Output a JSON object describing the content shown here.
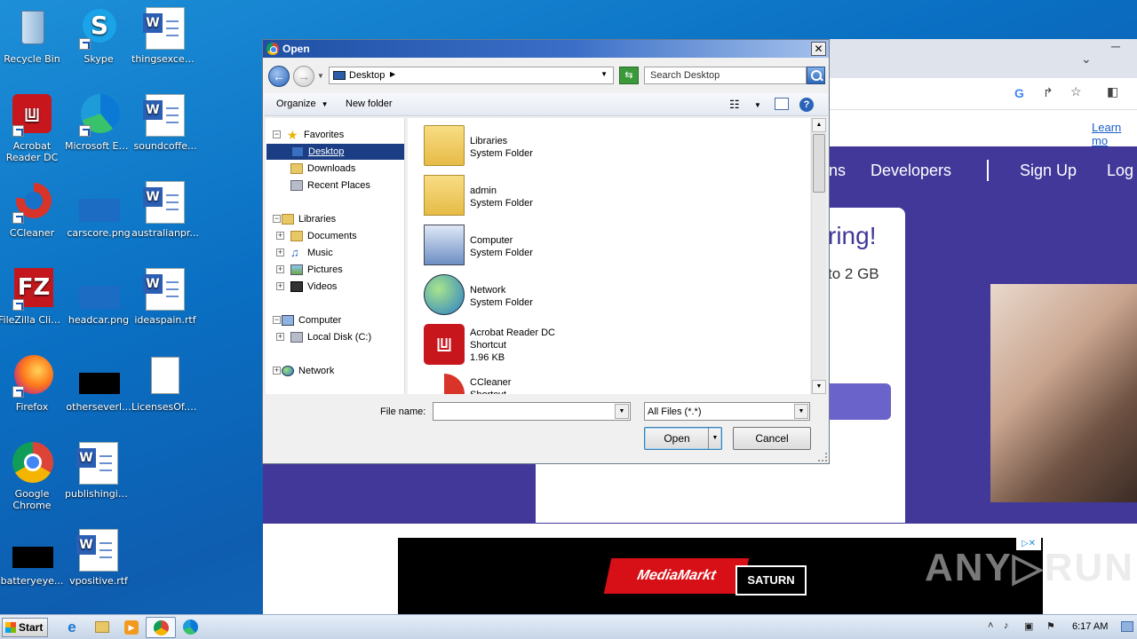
{
  "desktop": {
    "icons": [
      {
        "label": "Recycle Bin",
        "icon": "recycle-bin-icon"
      },
      {
        "label": "Skype",
        "icon": "skype-icon"
      },
      {
        "label": "thingsexcep...",
        "icon": "word-doc-icon"
      },
      {
        "label": "Acrobat Reader DC",
        "icon": "acrobat-icon"
      },
      {
        "label": "Microsoft Edge",
        "icon": "edge-icon"
      },
      {
        "label": "soundcoffe...",
        "icon": "word-doc-icon"
      },
      {
        "label": "CCleaner",
        "icon": "ccleaner-icon"
      },
      {
        "label": "carscore.png",
        "icon": "image-icon"
      },
      {
        "label": "australianpr...",
        "icon": "word-doc-icon"
      },
      {
        "label": "FileZilla Client",
        "icon": "filezilla-icon"
      },
      {
        "label": "headcar.png",
        "icon": "image-icon"
      },
      {
        "label": "ideaspain.rtf",
        "icon": "word-doc-icon"
      },
      {
        "label": "Firefox",
        "icon": "firefox-icon"
      },
      {
        "label": "otherseverl...",
        "icon": "black-thumbnail-icon"
      },
      {
        "label": "LicensesOf.txt",
        "icon": "text-file-icon"
      },
      {
        "label": "Google Chrome",
        "icon": "chrome-icon"
      },
      {
        "label": "publishingin...",
        "icon": "word-doc-icon"
      },
      {
        "label": "batteryeye...",
        "icon": "black-thumbnail-icon"
      },
      {
        "label": "vpositive.rtf",
        "icon": "word-doc-icon"
      }
    ]
  },
  "browser": {
    "learn_more": "Learn mo",
    "nav": [
      "ns",
      "Developers",
      "Sign Up",
      "Log"
    ],
    "headline": "ring!",
    "subline": "to 2 GB",
    "ad": {
      "brand1": "MediaMarkt",
      "brand2": "SATURN",
      "badge": "▷✕"
    },
    "watermark": "ANY▷RUN"
  },
  "dialog": {
    "title": "Open",
    "address": "Desktop",
    "search_placeholder": "Search Desktop",
    "toolbar": {
      "organize": "Organize",
      "new_folder": "New folder"
    },
    "tree": {
      "favorites": "Favorites",
      "desktop": "Desktop",
      "downloads": "Downloads",
      "recent": "Recent Places",
      "libraries": "Libraries",
      "documents": "Documents",
      "music": "Music",
      "pictures": "Pictures",
      "videos": "Videos",
      "computer": "Computer",
      "local_disk": "Local Disk (C:)",
      "network": "Network"
    },
    "files": [
      {
        "name": "Libraries",
        "type": "System Folder",
        "size": ""
      },
      {
        "name": "admin",
        "type": "System Folder",
        "size": ""
      },
      {
        "name": "Computer",
        "type": "System Folder",
        "size": ""
      },
      {
        "name": "Network",
        "type": "System Folder",
        "size": ""
      },
      {
        "name": "Acrobat Reader DC",
        "type": "Shortcut",
        "size": "1.96 KB"
      },
      {
        "name": "CCleaner",
        "type": "Shortcut",
        "size": ""
      }
    ],
    "file_name_label": "File name:",
    "file_name_value": "",
    "file_type": "All Files (*.*)",
    "open_button": "Open",
    "cancel_button": "Cancel"
  },
  "taskbar": {
    "start": "Start",
    "clock": "6:17 AM"
  }
}
